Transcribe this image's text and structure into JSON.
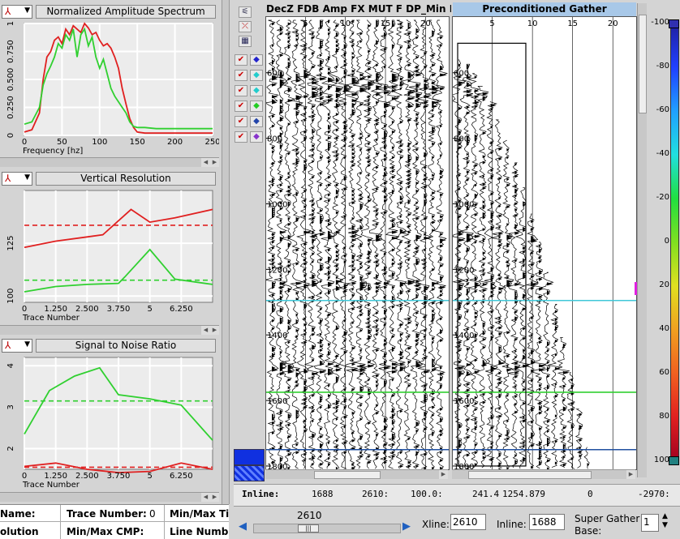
{
  "panels": [
    {
      "id": "spectrum",
      "title": "Normalized Amplitude Spectrum",
      "xlabel": "Frequency [hz]",
      "xticks": [
        "0",
        "50",
        "100",
        "150",
        "200",
        "250"
      ],
      "yticks": [
        "0",
        "0.250",
        "0.500",
        "0.750",
        "1"
      ]
    },
    {
      "id": "resolution",
      "title": "Vertical Resolution",
      "xlabel": "Trace Number",
      "xticks": [
        "0",
        "1.250",
        "2.500",
        "3.750",
        "5",
        "6.250"
      ],
      "yticks": [
        "100",
        "125"
      ]
    },
    {
      "id": "snr",
      "title": "Signal to Noise Ratio",
      "xlabel": "Trace Number",
      "xticks": [
        "0",
        "1.250",
        "2.500",
        "3.750",
        "5",
        "6.250"
      ],
      "yticks": [
        "2",
        "3",
        "4"
      ]
    }
  ],
  "chart_data": [
    {
      "type": "line",
      "title": "Normalized Amplitude Spectrum",
      "xlabel": "Frequency [hz]",
      "ylabel": "",
      "xlim": [
        0,
        250
      ],
      "ylim": [
        0,
        1
      ],
      "grid": true,
      "series": [
        {
          "color": "#e02020",
          "x": [
            0,
            10,
            20,
            25,
            30,
            35,
            40,
            45,
            50,
            55,
            60,
            65,
            70,
            75,
            80,
            85,
            90,
            95,
            100,
            105,
            110,
            115,
            120,
            125,
            130,
            135,
            140,
            145,
            150,
            160,
            175,
            200,
            225,
            250
          ],
          "y": [
            0.03,
            0.05,
            0.2,
            0.5,
            0.7,
            0.75,
            0.85,
            0.88,
            0.82,
            0.95,
            0.9,
            0.98,
            0.95,
            0.92,
            1.0,
            0.96,
            0.9,
            0.92,
            0.85,
            0.8,
            0.82,
            0.78,
            0.7,
            0.6,
            0.42,
            0.28,
            0.15,
            0.07,
            0.03,
            0.02,
            0.02,
            0.02,
            0.02,
            0.02
          ]
        },
        {
          "color": "#30d030",
          "x": [
            0,
            10,
            20,
            25,
            30,
            35,
            40,
            45,
            50,
            55,
            60,
            65,
            70,
            75,
            80,
            85,
            90,
            95,
            100,
            105,
            110,
            115,
            120,
            125,
            130,
            135,
            140,
            145,
            150,
            160,
            175,
            200,
            225,
            250
          ],
          "y": [
            0.1,
            0.12,
            0.25,
            0.45,
            0.55,
            0.62,
            0.7,
            0.82,
            0.78,
            0.9,
            0.85,
            0.95,
            0.7,
            0.9,
            0.95,
            0.8,
            0.88,
            0.7,
            0.6,
            0.68,
            0.55,
            0.42,
            0.35,
            0.3,
            0.25,
            0.2,
            0.12,
            0.08,
            0.07,
            0.07,
            0.06,
            0.06,
            0.06,
            0.06
          ]
        }
      ]
    },
    {
      "type": "line",
      "title": "Vertical Resolution",
      "xlabel": "Trace Number",
      "ylabel": "",
      "xlim": [
        0,
        7.5
      ],
      "ylim": [
        97,
        150
      ],
      "grid": true,
      "series": [
        {
          "color": "#e02020",
          "x": [
            0,
            1.25,
            2.5,
            3.125,
            4.25,
            5,
            6,
            7.5
          ],
          "y": [
            123,
            126,
            128,
            129,
            141,
            135,
            137,
            141
          ]
        },
        {
          "color": "#30d030",
          "x": [
            0,
            1.25,
            2.5,
            3.75,
            4.0,
            5,
            6,
            7.5
          ],
          "y": [
            102,
            104.5,
            105.5,
            106,
            109,
            122,
            108,
            105.5
          ]
        }
      ],
      "reference_lines": [
        {
          "color": "#e02020",
          "y": 133.5
        },
        {
          "color": "#30d030",
          "y": 107.5
        }
      ]
    },
    {
      "type": "line",
      "title": "Signal to Noise Ratio",
      "xlabel": "Trace Number",
      "ylabel": "",
      "xlim": [
        0,
        7.5
      ],
      "ylim": [
        1.5,
        4.2
      ],
      "grid": true,
      "series": [
        {
          "color": "#30d030",
          "x": [
            0,
            1,
            2,
            3,
            3.75,
            5,
            6.25,
            7.5
          ],
          "y": [
            2.35,
            3.4,
            3.75,
            3.95,
            3.3,
            3.2,
            3.05,
            2.2
          ]
        },
        {
          "color": "#e02020",
          "x": [
            0,
            1.25,
            2.5,
            3.75,
            5,
            6.25,
            7.5
          ],
          "y": [
            1.57,
            1.65,
            1.5,
            1.42,
            1.45,
            1.65,
            1.5
          ]
        }
      ],
      "reference_lines": [
        {
          "color": "#30d030",
          "y": 3.15
        },
        {
          "color": "#e02020",
          "y": 1.55
        }
      ]
    }
  ],
  "left_gather": {
    "title": "DecZ FDB Amp FX MUT F DP_Min For AV",
    "xticks": [
      "5",
      "10",
      "15",
      "20"
    ],
    "yticks": [
      "600",
      "800",
      "1000",
      "1200",
      "1400",
      "1600",
      "1800"
    ]
  },
  "right_gather": {
    "title": "Preconditioned Gather",
    "xticks": [
      "5",
      "10",
      "15",
      "20"
    ],
    "yticks": [
      "600",
      "800",
      "1000",
      "1200",
      "1400",
      "1600",
      "1800"
    ]
  },
  "horizons": [
    {
      "color": "#40c8d8",
      "time": 1295
    },
    {
      "color": "#30d030",
      "time": 1575
    },
    {
      "color": "#2050a0",
      "time": 1750
    }
  ],
  "colorbar": {
    "ticks": [
      "-100",
      "-80",
      "-60",
      "-40",
      "-20",
      "0",
      "20",
      "40",
      "60",
      "80",
      "100"
    ],
    "colors": [
      "#2020a0",
      "#2040ff",
      "#20a0ff",
      "#20e0e0",
      "#20e040",
      "#80e020",
      "#e0e020",
      "#f0a020",
      "#f06020",
      "#e02020",
      "#a00020"
    ]
  },
  "info_bar": {
    "label": "Inline:",
    "values": [
      "1688",
      "2610:",
      "100.0:",
      "241.4",
      "1254.879",
      "0",
      "-2970:"
    ]
  },
  "bottom_table": [
    [
      "Name:",
      "Trace Number:",
      "0",
      "Min/Max Ti"
    ],
    [
      "olution",
      "Min/Max CMP:",
      "",
      "Line Numb"
    ]
  ],
  "controls": {
    "slider_value": "2610",
    "xline_label": "Xline:",
    "xline_value": "2610",
    "inline_label": "Inline:",
    "inline_value": "1688",
    "super_gather_label": "Super Gather",
    "super_gather_label2": "Base:",
    "super_gather_value": "1"
  }
}
